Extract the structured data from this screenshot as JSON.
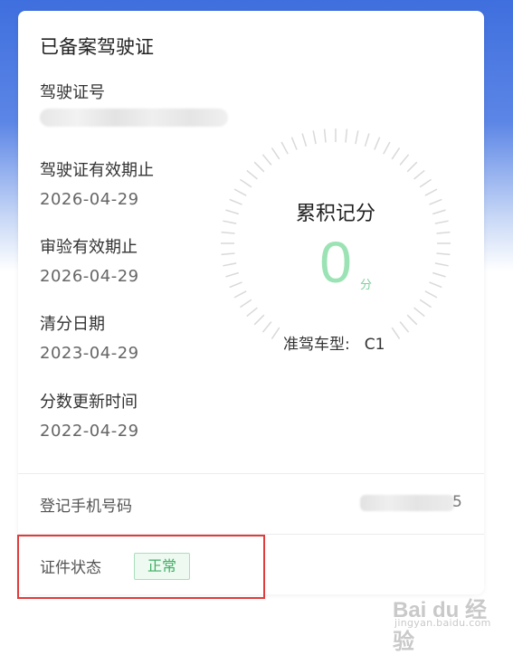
{
  "card": {
    "title": "已备案驾驶证",
    "license_number": {
      "label": "驾驶证号"
    },
    "fields": [
      {
        "label": "驾驶证有效期止",
        "value": "2026-04-29"
      },
      {
        "label": "审验有效期止",
        "value": "2026-04-29"
      },
      {
        "label": "清分日期",
        "value": "2023-04-29"
      },
      {
        "label": "分数更新时间",
        "value": "2022-04-29"
      }
    ],
    "score": {
      "title": "累积记分",
      "value": "0",
      "unit": "分",
      "value_color": "#9be3b4"
    },
    "vehicle": {
      "label": "准驾车型:",
      "value": "C1"
    },
    "phone": {
      "label": "登记手机号码",
      "visible_tail": "5"
    },
    "status": {
      "label": "证件状态",
      "badge": "正常",
      "badge_color": "#3fae64"
    }
  },
  "colors": {
    "header_blue": "#3f6fde",
    "highlight_red": "#e23b3b"
  },
  "watermark": {
    "main": "Bai du 经验",
    "sub": "jingyan.baidu.com"
  }
}
